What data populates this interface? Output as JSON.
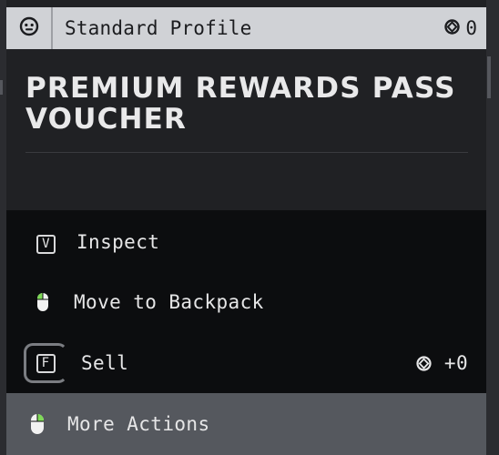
{
  "header": {
    "title": "Standard Profile",
    "currency_value": "0",
    "info_icon": "info-circle-icon",
    "currency_icon": "currency-coin-icon"
  },
  "item": {
    "title": "PREMIUM REWARDS PASS VOUCHER"
  },
  "actions": [
    {
      "key": "V",
      "label": "Inspect",
      "input": "keyboard"
    },
    {
      "label": "Move to Backpack",
      "input": "mouse-left-click"
    },
    {
      "key": "F",
      "label": "Sell",
      "input": "keyboard-hold",
      "value": "+0",
      "value_icon": "currency-coin-icon"
    },
    {
      "label": "More Actions",
      "input": "mouse-right-click",
      "highlighted": true
    }
  ],
  "colors": {
    "header_bg": "#d0d2d6",
    "panel_bg": "#202124",
    "actions_bg": "#0c0d0f",
    "highlight_bg": "#55585e",
    "mouse_accent": "#7ed957"
  }
}
